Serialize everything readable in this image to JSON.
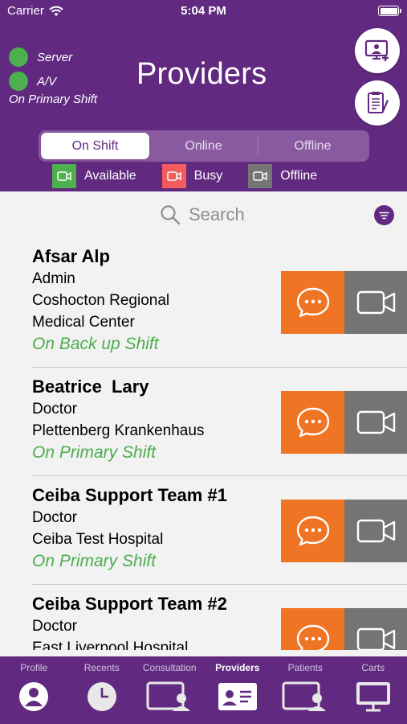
{
  "status_bar": {
    "carrier": "Carrier",
    "time": "5:04 PM"
  },
  "header": {
    "title": "Providers",
    "indicators": [
      {
        "label": "Server",
        "color": "#4cb04e"
      },
      {
        "label": "A/V",
        "color": "#4cb04e"
      }
    ],
    "shift_note": "On Primary Shift",
    "buttons": [
      {
        "icon": "add-consultation-icon"
      },
      {
        "icon": "clipboard-notes-icon"
      }
    ]
  },
  "segments": {
    "items": [
      "On Shift",
      "Online",
      "Offline"
    ],
    "selected": "On Shift"
  },
  "legend": [
    {
      "label": "Available",
      "color": "#4cb04e"
    },
    {
      "label": "Busy",
      "color": "#f25c5c"
    },
    {
      "label": "Offline",
      "color": "#757575"
    }
  ],
  "search": {
    "placeholder": "Search"
  },
  "providers": [
    {
      "name": "Afsar Alp",
      "role": "Admin",
      "facility": [
        "Coshocton Regional",
        "Medical Center"
      ],
      "shift": "On Back up Shift"
    },
    {
      "name": "Beatrice  Lary",
      "role": "Doctor",
      "facility": [
        "Plettenberg Krankenhaus"
      ],
      "shift": "On Primary Shift"
    },
    {
      "name": "Ceiba Support Team #1",
      "role": "Doctor",
      "facility": [
        "Ceiba Test Hospital"
      ],
      "shift": "On Primary Shift"
    },
    {
      "name": "Ceiba Support Team #2",
      "role": "Doctor",
      "facility": [
        "East Liverpool Hospital"
      ],
      "shift": ""
    }
  ],
  "tabs": [
    {
      "label": "Profile",
      "icon": "person-icon"
    },
    {
      "label": "Recents",
      "icon": "clock-icon"
    },
    {
      "label": "Consultation",
      "icon": "consultation-icon"
    },
    {
      "label": "Providers",
      "icon": "id-card-icon"
    },
    {
      "label": "Patients",
      "icon": "patients-icon"
    },
    {
      "label": "Carts",
      "icon": "monitor-icon"
    }
  ],
  "active_tab": "Providers",
  "colors": {
    "brand": "#612a80",
    "chat": "#ef7423",
    "video": "#747474",
    "shift_text": "#4cae4c"
  }
}
